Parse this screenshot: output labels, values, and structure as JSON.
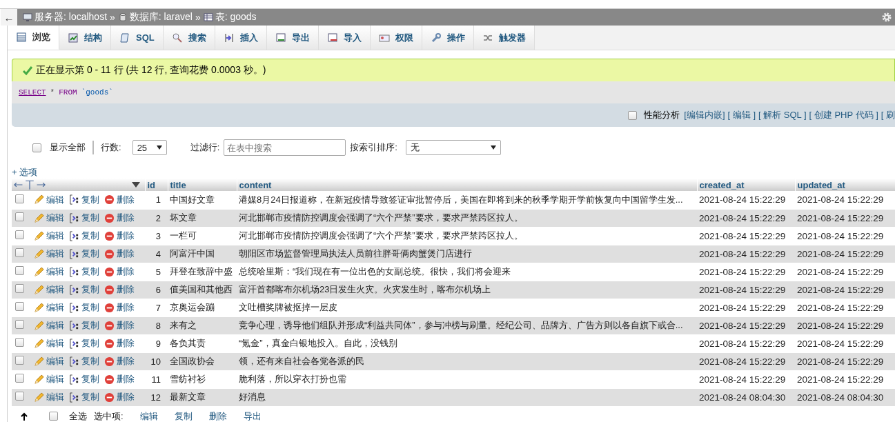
{
  "breadcrumb": {
    "back": "←",
    "items": [
      {
        "kind": "server",
        "label": "服务器: localhost"
      },
      {
        "kind": "database",
        "label": "数据库: laravel"
      },
      {
        "kind": "table",
        "label": "表: goods"
      }
    ],
    "separator": "»"
  },
  "tabs": [
    {
      "label": "浏览",
      "selected": true
    },
    {
      "label": "结构",
      "selected": false
    },
    {
      "label": "SQL",
      "selected": false
    },
    {
      "label": "搜索",
      "selected": false
    },
    {
      "label": "插入",
      "selected": false
    },
    {
      "label": "导出",
      "selected": false
    },
    {
      "label": "导入",
      "selected": false
    },
    {
      "label": "权限",
      "selected": false
    },
    {
      "label": "操作",
      "selected": false
    },
    {
      "label": "触发器",
      "selected": false
    }
  ],
  "message": "正在显示第 0 - 11 行 (共 12 行, 查询花费 0.0003 秒。)",
  "sql": {
    "keyword1": "SELECT",
    "star": "*",
    "keyword2": "FROM",
    "table": "`goods`"
  },
  "sql_options": {
    "profiling": {
      "label": "性能分析",
      "checked": false
    },
    "links": [
      "[编辑内嵌]",
      "[ 编辑 ]",
      "[ 解析 SQL ]",
      "[ 创建 PHP 代码 ]",
      "[ 刷"
    ]
  },
  "controls": {
    "show_all": {
      "label": "显示全部",
      "checked": false
    },
    "rows_label": "行数:",
    "rows_value": "25",
    "filter_label": "过滤行:",
    "filter_placeholder": "在表中搜索",
    "sort_label": "按索引排序:",
    "sort_value": "无"
  },
  "options_link": "+ 选项",
  "table": {
    "columns": [
      "id",
      "title",
      "content",
      "created_at",
      "updated_at"
    ],
    "rows": [
      {
        "checked": false,
        "actions": [
          "编辑",
          "复制",
          "删除"
        ],
        "id": "1",
        "title": "中国好文章",
        "content": "港媒8月24日报道称，在新冠疫情导致签证审批暂停后，美国在即将到来的秋季学期开学前恢复向中国留学生发...",
        "created_at": "2021-08-24 15:22:29",
        "updated_at": "2021-08-24 15:22:29"
      },
      {
        "checked": false,
        "actions": [
          "编辑",
          "复制",
          "删除"
        ],
        "id": "2",
        "title": "坏文章",
        "content": "河北邯郸市疫情防控调度会强调了“六个严禁”要求，要求严禁跨区拉人。",
        "created_at": "2021-08-24 15:22:29",
        "updated_at": "2021-08-24 15:22:29"
      },
      {
        "checked": false,
        "actions": [
          "编辑",
          "复制",
          "删除"
        ],
        "id": "3",
        "title": "一栏可",
        "content": "河北邯郸市疫情防控调度会强调了“六个严禁”要求，要求严禁跨区拉人。",
        "created_at": "2021-08-24 15:22:29",
        "updated_at": "2021-08-24 15:22:29"
      },
      {
        "checked": false,
        "actions": [
          "编辑",
          "复制",
          "删除"
        ],
        "id": "4",
        "title": "阿富汗中国",
        "content": "朝阳区市场监督管理局执法人员前往胖哥俩肉蟹煲门店进行",
        "created_at": "2021-08-24 15:22:29",
        "updated_at": "2021-08-24 15:22:29"
      },
      {
        "checked": false,
        "actions": [
          "编辑",
          "复制",
          "删除"
        ],
        "id": "5",
        "title": "拜登在致辞中盛",
        "content": "总统哈里斯：“我们现在有一位出色的女副总统。很快，我们将会迎来",
        "created_at": "2021-08-24 15:22:29",
        "updated_at": "2021-08-24 15:22:29"
      },
      {
        "checked": false,
        "actions": [
          "编辑",
          "复制",
          "删除"
        ],
        "id": "6",
        "title": "值美国和其他西",
        "content": "富汗首都喀布尔机场23日发生火灾。火灾发生时，喀布尔机场上",
        "created_at": "2021-08-24 15:22:29",
        "updated_at": "2021-08-24 15:22:29"
      },
      {
        "checked": false,
        "actions": [
          "编辑",
          "复制",
          "删除"
        ],
        "id": "7",
        "title": "京奥运会蹦",
        "content": "文吐槽奖牌被抠掉一层皮",
        "created_at": "2021-08-24 15:22:29",
        "updated_at": "2021-08-24 15:22:29"
      },
      {
        "checked": false,
        "actions": [
          "编辑",
          "复制",
          "删除"
        ],
        "id": "8",
        "title": "来有之",
        "content": "竞争心理，诱导他们组队并形成“利益共同体”，参与冲榜与刷量。经纪公司、品牌方、广告方则以各自旗下或合...",
        "created_at": "2021-08-24 15:22:29",
        "updated_at": "2021-08-24 15:22:29"
      },
      {
        "checked": false,
        "actions": [
          "编辑",
          "复制",
          "删除"
        ],
        "id": "9",
        "title": "各负其责",
        "content": "“氪金”，真金白银地投入。自此，没钱别",
        "created_at": "2021-08-24 15:22:29",
        "updated_at": "2021-08-24 15:22:29"
      },
      {
        "checked": false,
        "actions": [
          "编辑",
          "复制",
          "删除"
        ],
        "id": "10",
        "title": "全国政协会",
        "content": "领，还有来自社会各党各派的民",
        "created_at": "2021-08-24 15:22:29",
        "updated_at": "2021-08-24 15:22:29"
      },
      {
        "checked": false,
        "actions": [
          "编辑",
          "复制",
          "删除"
        ],
        "id": "11",
        "title": "雪纺衬衫",
        "content": "脆利落，所以穿衣打扮也需",
        "created_at": "2021-08-24 15:22:29",
        "updated_at": "2021-08-24 15:22:29"
      },
      {
        "checked": false,
        "actions": [
          "编辑",
          "复制",
          "删除"
        ],
        "id": "12",
        "title": "最新文章",
        "content": "好消息",
        "created_at": "2021-08-24 08:04:30",
        "updated_at": "2021-08-24 08:04:30"
      }
    ]
  },
  "bulk": {
    "select_all": {
      "label": "全选",
      "checked": false
    },
    "with_selected": "选中项:",
    "actions": [
      "编辑",
      "复制",
      "删除",
      "导出"
    ]
  }
}
